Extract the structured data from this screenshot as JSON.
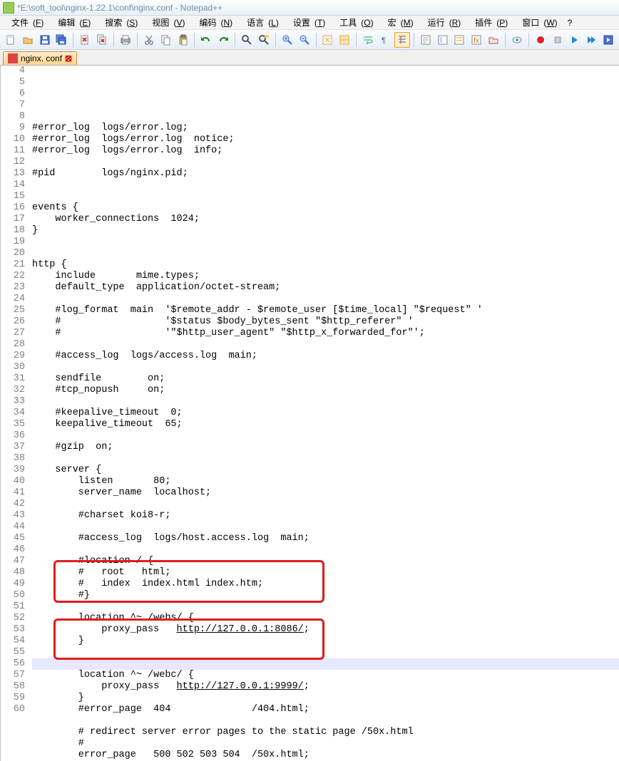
{
  "window": {
    "title": "*E:\\soft_tool\\nginx-1.22.1\\conf\\nginx.conf - Notepad++"
  },
  "menu": {
    "file": {
      "label": "文件",
      "hot": "F"
    },
    "edit": {
      "label": "编辑",
      "hot": "E"
    },
    "search": {
      "label": "搜索",
      "hot": "S"
    },
    "view": {
      "label": "视图",
      "hot": "V"
    },
    "encode": {
      "label": "编码",
      "hot": "N"
    },
    "lang": {
      "label": "语言",
      "hot": "L"
    },
    "settings": {
      "label": "设置",
      "hot": "T"
    },
    "tools": {
      "label": "工具",
      "hot": "O"
    },
    "macro": {
      "label": "宏",
      "hot": "M"
    },
    "run": {
      "label": "运行",
      "hot": "R"
    },
    "plugin": {
      "label": "插件",
      "hot": "P"
    },
    "window": {
      "label": "窗口",
      "hot": "W"
    },
    "help": {
      "label": "?"
    }
  },
  "tab": {
    "name": "nginx. conf"
  },
  "lines": [
    {
      "n": 4,
      "t": ""
    },
    {
      "n": 5,
      "t": "#error_log  logs/error.log;"
    },
    {
      "n": 6,
      "t": "#error_log  logs/error.log  notice;"
    },
    {
      "n": 7,
      "t": "#error_log  logs/error.log  info;"
    },
    {
      "n": 8,
      "t": ""
    },
    {
      "n": 9,
      "t": "#pid        logs/nginx.pid;"
    },
    {
      "n": 10,
      "t": ""
    },
    {
      "n": 11,
      "t": ""
    },
    {
      "n": 12,
      "t": "events {"
    },
    {
      "n": 13,
      "t": "    worker_connections  1024;"
    },
    {
      "n": 14,
      "t": "}"
    },
    {
      "n": 15,
      "t": ""
    },
    {
      "n": 16,
      "t": ""
    },
    {
      "n": 17,
      "t": "http {"
    },
    {
      "n": 18,
      "t": "    include       mime.types;"
    },
    {
      "n": 19,
      "t": "    default_type  application/octet-stream;"
    },
    {
      "n": 20,
      "t": ""
    },
    {
      "n": 21,
      "t": "    #log_format  main  '$remote_addr - $remote_user [$time_local] \"$request\" '"
    },
    {
      "n": 22,
      "t": "    #                  '$status $body_bytes_sent \"$http_referer\" '"
    },
    {
      "n": 23,
      "t": "    #                  '\"$http_user_agent\" \"$http_x_forwarded_for\"';"
    },
    {
      "n": 24,
      "t": ""
    },
    {
      "n": 25,
      "t": "    #access_log  logs/access.log  main;"
    },
    {
      "n": 26,
      "t": ""
    },
    {
      "n": 27,
      "t": "    sendfile        on;"
    },
    {
      "n": 28,
      "t": "    #tcp_nopush     on;"
    },
    {
      "n": 29,
      "t": ""
    },
    {
      "n": 30,
      "t": "    #keepalive_timeout  0;"
    },
    {
      "n": 31,
      "t": "    keepalive_timeout  65;"
    },
    {
      "n": 32,
      "t": ""
    },
    {
      "n": 33,
      "t": "    #gzip  on;"
    },
    {
      "n": 34,
      "t": ""
    },
    {
      "n": 35,
      "t": "    server {"
    },
    {
      "n": 36,
      "t": "        listen       80;"
    },
    {
      "n": 37,
      "t": "        server_name  localhost;"
    },
    {
      "n": 38,
      "t": ""
    },
    {
      "n": 39,
      "t": "        #charset koi8-r;"
    },
    {
      "n": 40,
      "t": ""
    },
    {
      "n": 41,
      "t": "        #access_log  logs/host.access.log  main;"
    },
    {
      "n": 42,
      "t": ""
    },
    {
      "n": 43,
      "t": "        #location / {"
    },
    {
      "n": 44,
      "t": "        #   root   html;"
    },
    {
      "n": 45,
      "t": "        #   index  index.html index.htm;"
    },
    {
      "n": 46,
      "t": "        #}"
    },
    {
      "n": 47,
      "t": ""
    },
    {
      "n": 48,
      "t": "        location ^~ /webs/ {"
    },
    {
      "n": 49,
      "t": "            proxy_pass   ",
      "link": "http://127.0.0.1:8086/",
      "after": ";"
    },
    {
      "n": 50,
      "t": "        }"
    },
    {
      "n": 51,
      "t": ""
    },
    {
      "n": 52,
      "t": "",
      "cur": true
    },
    {
      "n": 53,
      "t": "        location ^~ /webc/ {"
    },
    {
      "n": 54,
      "t": "            proxy_pass   ",
      "link": "http://127.0.0.1:9999/",
      "after": ";"
    },
    {
      "n": 55,
      "t": "        }"
    },
    {
      "n": 56,
      "t": "        #error_page  404              /404.html;"
    },
    {
      "n": 57,
      "t": ""
    },
    {
      "n": 58,
      "t": "        # redirect server error pages to the static page /50x.html"
    },
    {
      "n": 59,
      "t": "        #"
    },
    {
      "n": 60,
      "t": "        error_page   500 502 503 504  /50x.html;"
    }
  ]
}
